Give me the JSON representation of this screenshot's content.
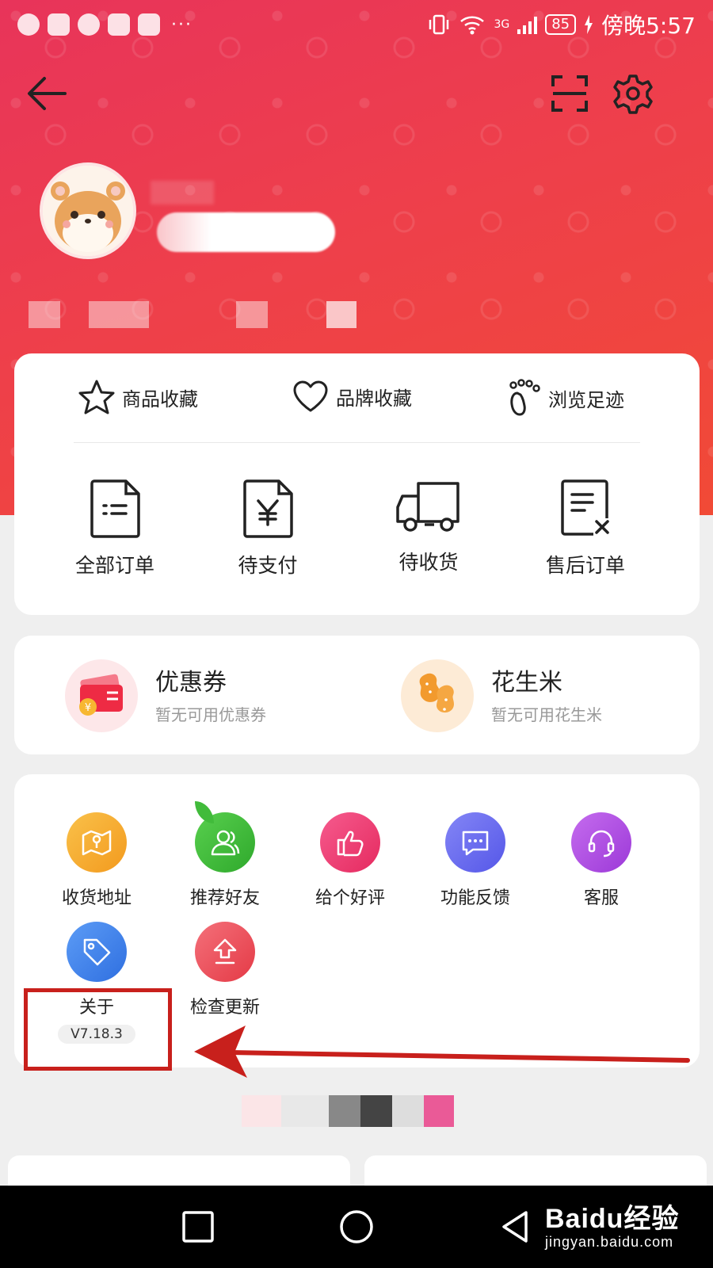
{
  "status_bar": {
    "time": "傍晚5:57",
    "battery": "85",
    "network": "3G"
  },
  "favorites": [
    {
      "label": "商品收藏",
      "icon": "star-icon"
    },
    {
      "label": "品牌收藏",
      "icon": "heart-icon"
    },
    {
      "label": "浏览足迹",
      "icon": "footprint-icon"
    }
  ],
  "orders": [
    {
      "label": "全部订单",
      "icon": "document-list-icon"
    },
    {
      "label": "待支付",
      "icon": "yuan-document-icon"
    },
    {
      "label": "待收货",
      "icon": "truck-icon"
    },
    {
      "label": "售后订单",
      "icon": "document-close-icon"
    }
  ],
  "assets": [
    {
      "title": "优惠券",
      "subtitle": "暂无可用优惠券",
      "icon": "coupon-icon"
    },
    {
      "title": "花生米",
      "subtitle": "暂无可用花生米",
      "icon": "peanut-icon"
    }
  ],
  "tools": [
    {
      "label": "收货地址",
      "icon": "map-icon",
      "color": "#f5a623"
    },
    {
      "label": "推荐好友",
      "icon": "friends-icon",
      "color": "#3dbb3a"
    },
    {
      "label": "给个好评",
      "icon": "thumbs-up-icon",
      "color": "#f0407a"
    },
    {
      "label": "功能反馈",
      "icon": "chat-icon",
      "color": "#6a6cf0"
    },
    {
      "label": "客服",
      "icon": "headset-icon",
      "color": "#b34ce0"
    },
    {
      "label": "关于",
      "icon": "tag-icon",
      "color": "#3b82f0",
      "version": "V7.18.3"
    },
    {
      "label": "检查更新",
      "icon": "upload-icon",
      "color": "#ef4a55"
    }
  ],
  "watermark": {
    "brand": "Baidu经验",
    "url": "jingyan.baidu.com"
  },
  "colors": {
    "header_start": "#e8345a",
    "header_end": "#f14a36",
    "annotation": "#c8201c"
  }
}
